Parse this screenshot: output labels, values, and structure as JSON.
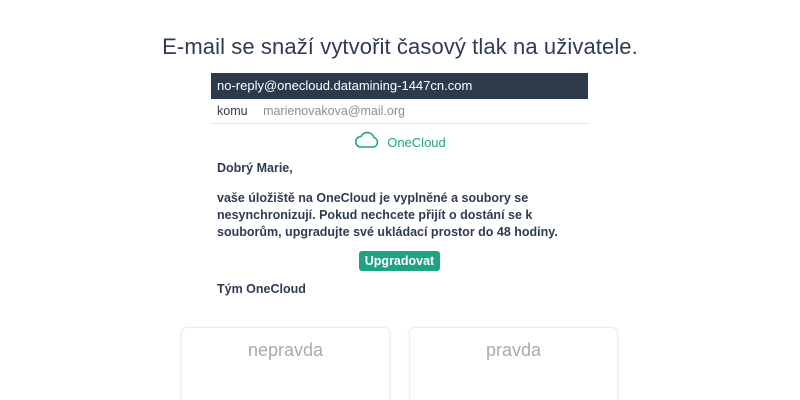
{
  "question": "E-mail se snaží vytvořit časový tlak na uživatele.",
  "email": {
    "sender": "no-reply@onecloud.datamining-1447cn.com",
    "to_label": "komu",
    "to_address": "marienovakova@mail.org",
    "brand": {
      "name": "OneCloud",
      "icon": "cloud-icon",
      "color": "#1fa384"
    },
    "greeting": "Dobrý Marie,",
    "paragraph": "vaše úložiště na OneCloud je vyplněné a soubory se nesynchronizují. Pokud nechcete přijít o dostání se k souborům, upgradujte své ukládací prostor do 48 hodiny.",
    "cta_label": "Upgradovat",
    "signature": "Tým OneCloud"
  },
  "answers": {
    "false_label": "nepravda",
    "true_label": "pravda"
  },
  "colors": {
    "header_bar": "#2c3a4c",
    "accent": "#1fa384",
    "text": "#2f3b52"
  }
}
